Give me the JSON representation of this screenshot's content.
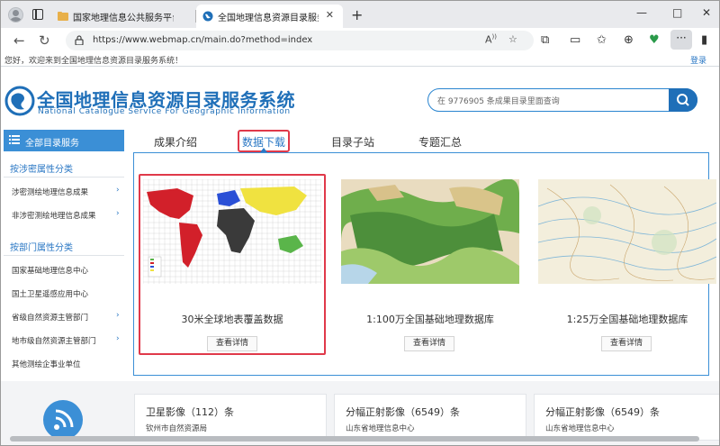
{
  "browser": {
    "tabs": [
      {
        "title": "国家地理信息公共服务平台 天地图",
        "active": false
      },
      {
        "title": "全国地理信息资源目录服务系统",
        "active": true
      }
    ],
    "url": "https://www.webmap.cn/main.do?method=index",
    "window_controls": [
      "—",
      "□",
      "✕"
    ]
  },
  "header": {
    "welcome": "您好，欢迎来到全国地理信息资源目录服务系统！",
    "login": "登录",
    "title": "全国地理信息资源目录服务系统",
    "subtitle": "National Catalogue Service For Geographic Information",
    "search_placeholder": "在 9776905 条成果目录里面查询"
  },
  "sidebar": {
    "head": "全部目录服务",
    "categories": [
      {
        "label": "按涉密属性分类",
        "items": [
          {
            "label": "涉密测绘地理信息成果",
            "arrow": true
          },
          {
            "label": "非涉密测绘地理信息成果",
            "arrow": true
          }
        ]
      },
      {
        "label": "按部门属性分类",
        "items": [
          {
            "label": "国家基础地理信息中心",
            "arrow": false
          },
          {
            "label": "国土卫星遥感应用中心",
            "arrow": false
          },
          {
            "label": "省级自然资源主管部门",
            "arrow": true
          },
          {
            "label": "地市级自然资源主管部门",
            "arrow": true
          },
          {
            "label": "其他测绘企事业单位",
            "arrow": false
          }
        ]
      }
    ]
  },
  "nav": {
    "tabs": [
      {
        "label": "成果介绍"
      },
      {
        "label": "数据下载",
        "active": true
      },
      {
        "label": "目录子站"
      },
      {
        "label": "专题汇总"
      }
    ]
  },
  "cards": [
    {
      "title": "30米全球地表覆盖数据",
      "button": "查看详情",
      "highlighted": true
    },
    {
      "title": "1:100万全国基础地理数据库",
      "button": "查看详情"
    },
    {
      "title": "1:25万全国基础地理数据库",
      "button": "查看详情"
    }
  ],
  "bottom_cards": [
    {
      "title": "卫星影像（112）条",
      "source": "钦州市自然资源局"
    },
    {
      "title": "分幅正射影像（6549）条",
      "source": "山东省地理信息中心"
    },
    {
      "title": "分幅正射影像（6549）条",
      "source": "山东省地理信息中心"
    }
  ],
  "colors": {
    "brand_blue": "#1f6fb8",
    "sidebar_head": "#3b8fd6",
    "highlight_red": "#e0394a"
  }
}
